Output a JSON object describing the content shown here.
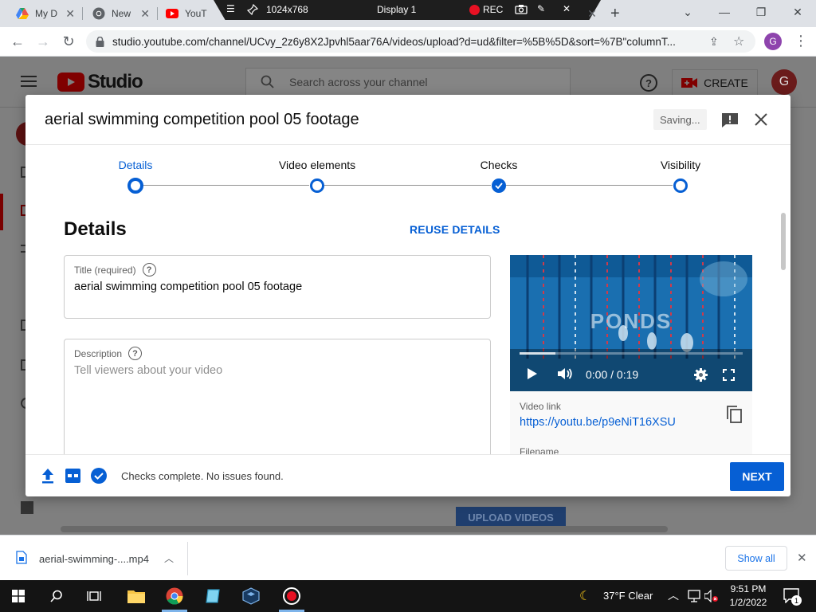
{
  "browser": {
    "tabs": [
      {
        "label": "My D",
        "icon": "google-drive-icon"
      },
      {
        "label": "New",
        "icon": "chrome-icon"
      },
      {
        "label": "YouT",
        "icon": "youtube-icon"
      }
    ],
    "new_tab_symbol": "+",
    "url": "studio.youtube.com/channel/UCvy_2z6y8X2Jpvhl5aar76A/videos/upload?d=ud&filter=%5B%5D&sort=%7B\"columnT...",
    "profile_initial": "G"
  },
  "recorder": {
    "resolution": "1024x768",
    "display": "Display 1",
    "rec_label": "REC"
  },
  "studio": {
    "logo_text": "Studio",
    "search_placeholder": "Search across your channel",
    "create_label": "CREATE",
    "avatar_initial": "G",
    "bg_upload_label": "UPLOAD VIDEOS"
  },
  "modal": {
    "title": "aerial swimming competition pool 05 footage",
    "saving_label": "Saving...",
    "steps": [
      {
        "label": "Details",
        "state": "current"
      },
      {
        "label": "Video elements",
        "state": "pending"
      },
      {
        "label": "Checks",
        "state": "done"
      },
      {
        "label": "Visibility",
        "state": "pending"
      }
    ],
    "section_heading": "Details",
    "reuse_label": "REUSE DETAILS",
    "title_field": {
      "label": "Title (required)",
      "value": "aerial swimming competition pool 05 footage"
    },
    "description_field": {
      "label": "Description",
      "placeholder": "Tell viewers about your video"
    },
    "video": {
      "watermark": "PONDS",
      "time": "0:00 / 0:19",
      "progress_buffered": 0.16,
      "link_label": "Video link",
      "link": "https://youtu.be/p9eNiT16XSU",
      "filename_label": "Filename"
    },
    "footer": {
      "status": "Checks complete. No issues found.",
      "next_label": "NEXT"
    }
  },
  "downloads": {
    "file": "aerial-swimming-....mp4",
    "show_all_label": "Show all"
  },
  "taskbar": {
    "weather": "37°F  Clear",
    "time": "9:51 PM",
    "date": "1/2/2022",
    "notification_count": "1"
  },
  "colors": {
    "accent": "#065fd4",
    "youtube_red": "#ff0000",
    "overlay": "#7f7f7f"
  }
}
